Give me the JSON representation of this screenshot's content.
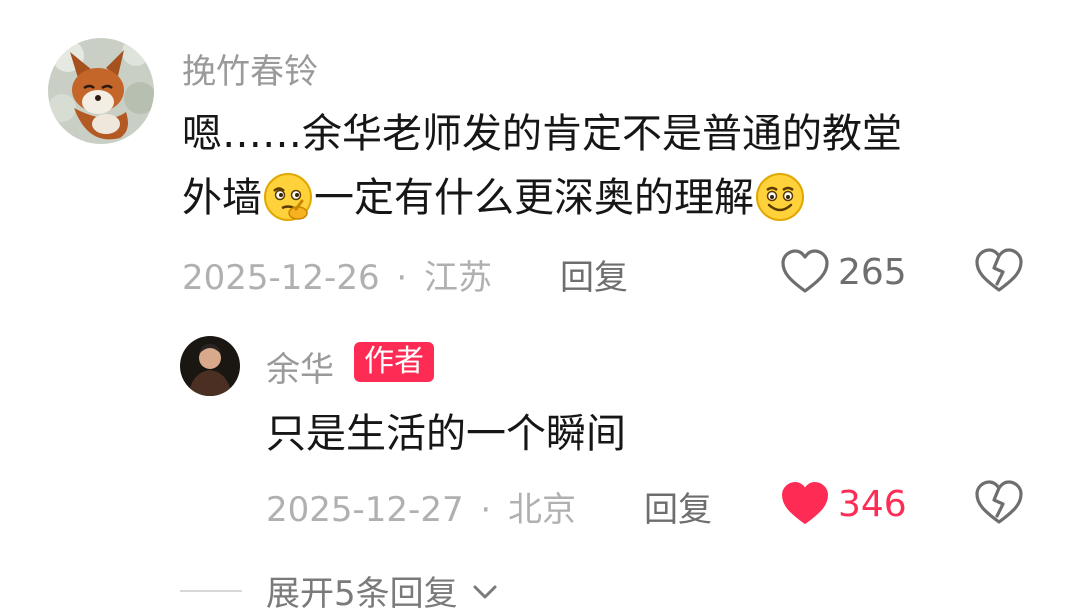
{
  "comment": {
    "username": "挽竹春铃",
    "text_line1": "嗯……余华老师发的肯定不是普通的教堂",
    "text_line2_part1": "外墙",
    "emoji1": "thinking-face",
    "text_line2_part2": "一定有什么更深奥的理解",
    "emoji2": "smiling-face",
    "date": "2025-12-26",
    "separator": "·",
    "location": "江苏",
    "reply_label": "回复",
    "likes": "265",
    "liked": false
  },
  "reply": {
    "username": "余华",
    "badge": "作者",
    "text": "只是生活的一个瞬间",
    "date": "2025-12-27",
    "separator": "·",
    "location": "北京",
    "reply_label": "回复",
    "likes": "346",
    "liked": true
  },
  "expand": {
    "label": "展开5条回复"
  },
  "colors": {
    "like_active": "#fe2c55",
    "badge": "#fe2c55",
    "muted_text": "#9a9a9a"
  }
}
